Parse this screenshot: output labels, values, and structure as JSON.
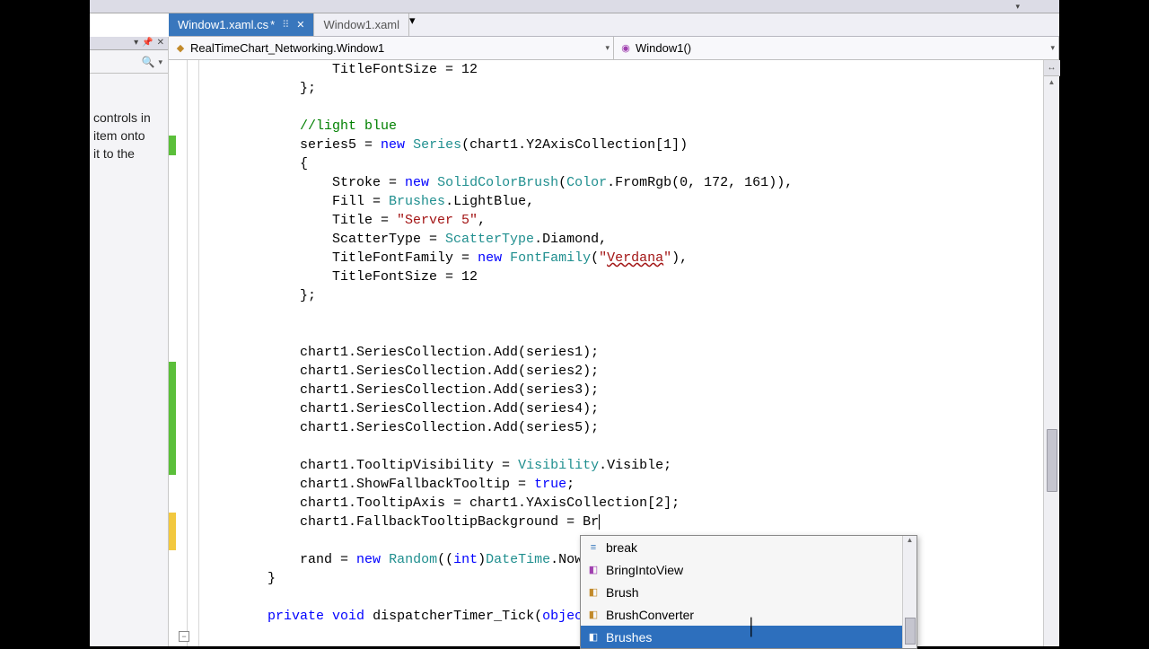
{
  "tabs": {
    "active": {
      "label": "Window1.xaml.cs",
      "dirty": "*"
    },
    "inactive": {
      "label": "Window1.xaml"
    }
  },
  "nav": {
    "left": "RealTimeChart_Networking.Window1",
    "right": "Window1()"
  },
  "sidepanel": {
    "line1": "  controls in",
    "line2": "  item onto",
    "line3": "it to the"
  },
  "code": {
    "l01a": "                TitleFontSize = ",
    "l01n": "12",
    "l02": "            };",
    "l03": "",
    "l04c": "            //light blue",
    "l05a": "            series5 = ",
    "l05k": "new",
    "l05b": " ",
    "l05t": "Series",
    "l05c": "(chart1.Y2AxisCollection[",
    "l05n": "1",
    "l05d": "])",
    "l06": "            {",
    "l07a": "                Stroke = ",
    "l07k": "new",
    "l07b": " ",
    "l07t": "SolidColorBrush",
    "l07c": "(",
    "l07t2": "Color",
    "l07d": ".FromRgb(",
    "l07n": "0, 172, 161",
    "l07e": ")),",
    "l08a": "                Fill = ",
    "l08t": "Brushes",
    "l08b": ".LightBlue,",
    "l09a": "                Title = ",
    "l09s": "\"Server 5\"",
    "l09b": ",",
    "l10a": "                ScatterType = ",
    "l10t": "ScatterType",
    "l10b": ".Diamond,",
    "l11a": "                TitleFontFamily = ",
    "l11k": "new",
    "l11b": " ",
    "l11t": "FontFamily",
    "l11c": "(",
    "l11s": "\"",
    "l11w": "Verdana",
    "l11s2": "\"",
    "l11d": "),",
    "l12a": "                TitleFontSize = ",
    "l12n": "12",
    "l13": "            };",
    "l14": "",
    "l15": "",
    "l16": "            chart1.SeriesCollection.Add(series1);",
    "l17": "            chart1.SeriesCollection.Add(series2);",
    "l18": "            chart1.SeriesCollection.Add(series3);",
    "l19": "            chart1.SeriesCollection.Add(series4);",
    "l20": "            chart1.SeriesCollection.Add(series5);",
    "l21": "",
    "l22a": "            chart1.TooltipVisibility = ",
    "l22t": "Visibility",
    "l22b": ".Visible;",
    "l23a": "            chart1.ShowFallbackTooltip = ",
    "l23k": "true",
    "l23b": ";",
    "l24": "            chart1.TooltipAxis = chart1.YAxisCollection[2];",
    "l25": "            chart1.FallbackTooltipBackground = Br",
    "l26": "",
    "l27a": "            rand = ",
    "l27k": "new",
    "l27b": " ",
    "l27t": "Random",
    "l27c": "((",
    "l27k2": "int",
    "l27d": ")",
    "l27t2": "DateTime",
    "l27e": ".Now",
    "l28": "        }",
    "l29": "",
    "l30a": "        ",
    "l30k": "private",
    "l30b": " ",
    "l30k2": "void",
    "l30c": " dispatcherTimer_Tick(",
    "l30k3": "object"
  },
  "intellisense": {
    "items": [
      {
        "label": "break",
        "kind": "snippet"
      },
      {
        "label": "BringIntoView",
        "kind": "method"
      },
      {
        "label": "Brush",
        "kind": "class"
      },
      {
        "label": "BrushConverter",
        "kind": "class"
      },
      {
        "label": "Brushes",
        "kind": "class",
        "selected": true
      }
    ]
  }
}
